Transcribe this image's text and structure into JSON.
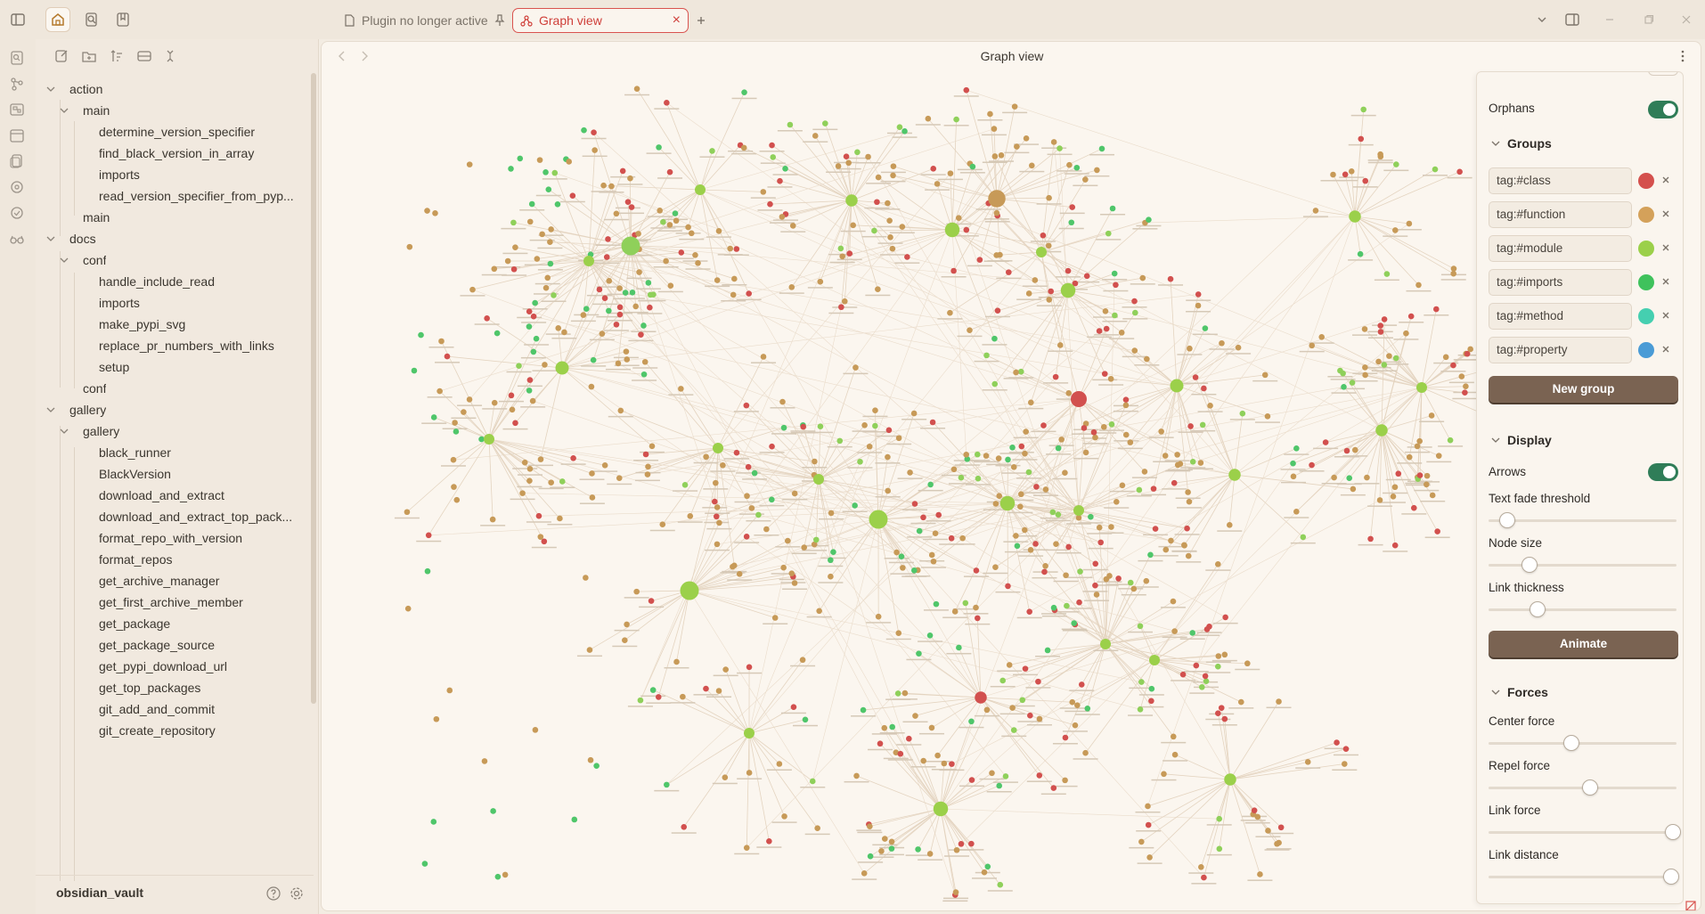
{
  "tabs": [
    {
      "label": "Plugin no longer active",
      "active": false
    },
    {
      "label": "Graph view",
      "active": true
    }
  ],
  "header": {
    "title": "Graph view"
  },
  "vault": {
    "name": "obsidian_vault"
  },
  "tree": {
    "action": "action",
    "action_main": "main",
    "action_main_items": [
      "determine_version_specifier",
      "find_black_version_in_array",
      "imports",
      "read_version_specifier_from_pyp..."
    ],
    "action_main_file": "main",
    "docs": "docs",
    "docs_conf": "conf",
    "docs_conf_items": [
      "handle_include_read",
      "imports",
      "make_pypi_svg",
      "replace_pr_numbers_with_links",
      "setup"
    ],
    "docs_conf_file": "conf",
    "gallery": "gallery",
    "gallery_gallery": "gallery",
    "gallery_items": [
      "black_runner",
      "BlackVersion",
      "download_and_extract",
      "download_and_extract_top_pack...",
      "format_repo_with_version",
      "format_repos",
      "get_archive_manager",
      "get_first_archive_member",
      "get_package",
      "get_package_source",
      "get_pypi_download_url",
      "get_top_packages",
      "git_add_and_commit",
      "git_create_repository"
    ]
  },
  "panel": {
    "orphans_label": "Orphans",
    "orphans_on": true,
    "groups_title": "Groups",
    "groups": [
      {
        "query": "tag:#class",
        "color": "#d4504d"
      },
      {
        "query": "tag:#function",
        "color": "#d4a15a"
      },
      {
        "query": "tag:#module",
        "color": "#9bd04a"
      },
      {
        "query": "tag:#imports",
        "color": "#3fc25c"
      },
      {
        "query": "tag:#method",
        "color": "#45cfb0"
      },
      {
        "query": "tag:#property",
        "color": "#4a9bd6"
      }
    ],
    "new_group": "New group",
    "display_title": "Display",
    "arrows_label": "Arrows",
    "arrows_on": true,
    "text_fade": "Text fade threshold",
    "text_fade_value": 0.1,
    "node_size": "Node size",
    "node_size_value": 0.22,
    "link_thickness": "Link thickness",
    "link_thickness_value": 0.26,
    "animate": "Animate",
    "forces_title": "Forces",
    "center_force": "Center force",
    "center_force_value": 0.44,
    "repel_force": "Repel force",
    "repel_force_value": 0.54,
    "link_force": "Link force",
    "link_force_value": 0.98,
    "link_distance": "Link distance",
    "link_distance_value": 0.97
  }
}
